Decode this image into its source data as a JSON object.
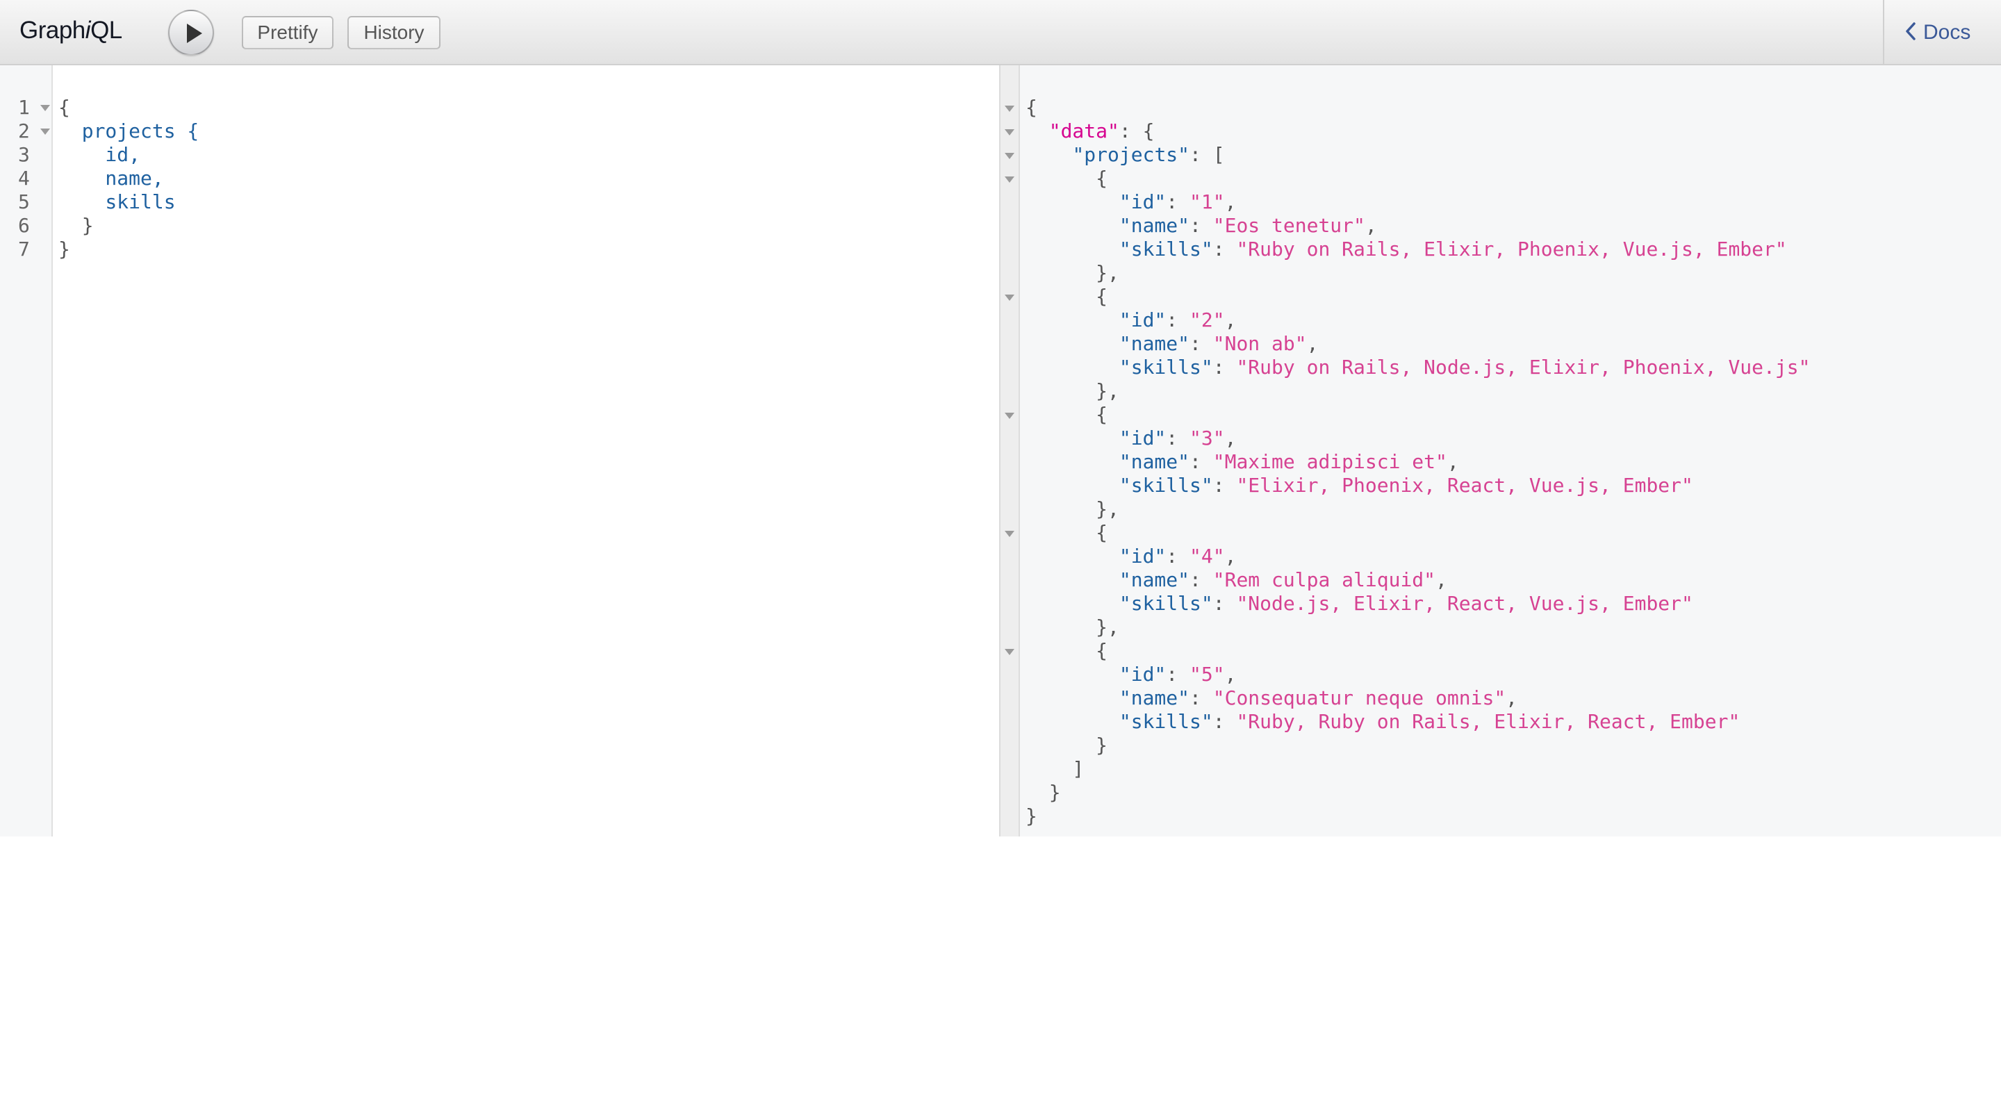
{
  "header": {
    "title_prefix": "Graph",
    "title_italic": "i",
    "title_suffix": "QL",
    "execute_icon": "play-icon",
    "prettify_label": "Prettify",
    "history_label": "History",
    "docs_label": "Docs",
    "docs_icon": "chevron-left-icon"
  },
  "colors": {
    "field": "#1f61a0",
    "string": "#d64292",
    "root_key": "#d60690",
    "link": "#3b5998"
  },
  "query": {
    "line_numbers": [
      "1",
      "2",
      "3",
      "4",
      "5",
      "6",
      "7"
    ],
    "lines": [
      "{",
      "  projects {",
      "    id,",
      "    name,",
      "    skills",
      "  }",
      "}"
    ]
  },
  "result": {
    "data_key": "\"data\"",
    "projects_key": "\"projects\"",
    "projects": [
      {
        "id": "\"1\"",
        "name": "\"Eos tenetur\"",
        "skills": "\"Ruby on Rails, Elixir, Phoenix, Vue.js, Ember\""
      },
      {
        "id": "\"2\"",
        "name": "\"Non ab\"",
        "skills": "\"Ruby on Rails, Node.js, Elixir, Phoenix, Vue.js\""
      },
      {
        "id": "\"3\"",
        "name": "\"Maxime adipisci et\"",
        "skills": "\"Elixir, Phoenix, React, Vue.js, Ember\""
      },
      {
        "id": "\"4\"",
        "name": "\"Rem culpa aliquid\"",
        "skills": "\"Node.js, Elixir, React, Vue.js, Ember\""
      },
      {
        "id": "\"5\"",
        "name": "\"Consequatur neque omnis\"",
        "skills": "\"Ruby, Ruby on Rails, Elixir, React, Ember\""
      }
    ]
  }
}
